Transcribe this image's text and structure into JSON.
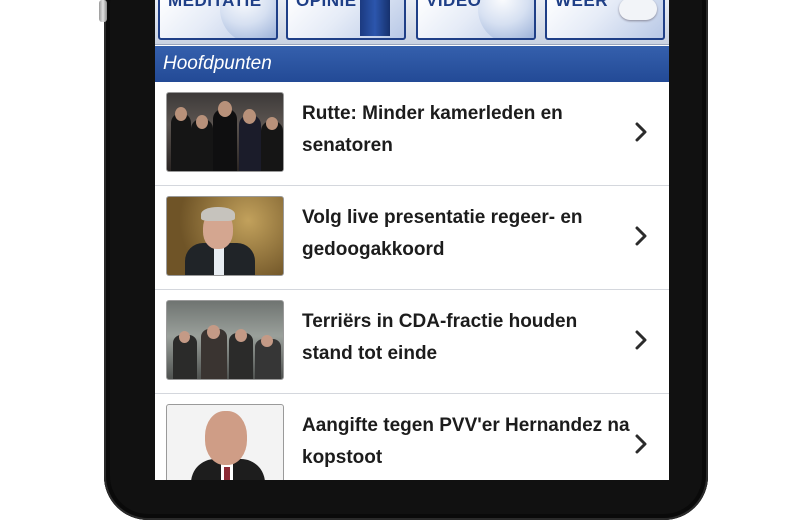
{
  "tiles": [
    {
      "label": "MEDITATIE",
      "style": "globe"
    },
    {
      "label": "OPINIE",
      "style": "pillar"
    },
    {
      "label": "VIDEO",
      "style": "globe"
    },
    {
      "label": "WEER",
      "style": "cloud"
    }
  ],
  "section": {
    "title": "Hoofdpunten"
  },
  "articles": [
    {
      "title": "Rutte: Minder kamerleden en senatoren",
      "thumb": "group-photo"
    },
    {
      "title": "Volg live presentatie regeer- en gedoogakkoord",
      "thumb": "portrait-speaker"
    },
    {
      "title": "Terriërs in CDA-fractie houden stand tot einde",
      "thumb": "crowd-photo"
    },
    {
      "title": "Aangifte tegen PVV'er Hernandez na kopstoot",
      "thumb": "portrait-politician"
    }
  ],
  "colors": {
    "header_blue": "#2a54a2",
    "tile_border": "#1f3f87",
    "text_dark": "#1c1c1c",
    "chevron": "#2b2b2b"
  },
  "icons": {
    "row_disclosure": "chevron-right-icon"
  }
}
